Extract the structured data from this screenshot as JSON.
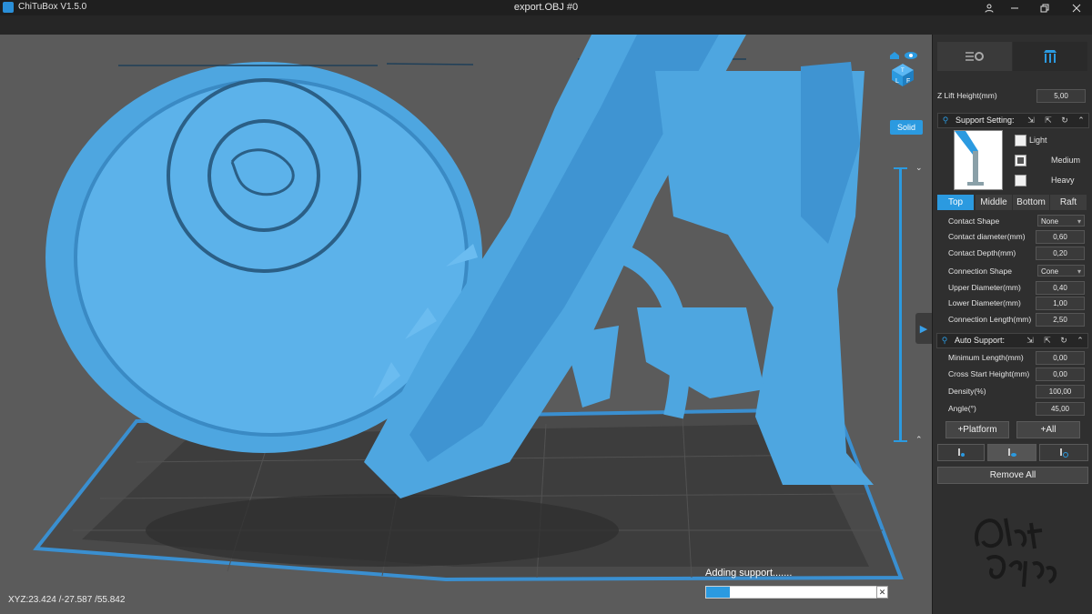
{
  "titlebar": {
    "app_name": "ChiTuBox V1.5.0",
    "document": "export.OBJ #0"
  },
  "viewport": {
    "display_mode": "Solid",
    "coordinates": "XYZ:23.424 /-27.587 /55.842",
    "progress": {
      "label": "Adding support.......",
      "fraction": 0.14
    }
  },
  "panel": {
    "z_lift": {
      "label": "Z Lift Height(mm)",
      "value": "5,00"
    },
    "support_setting": {
      "title": "Support Setting:",
      "presets": [
        {
          "label": "Light",
          "checked": false
        },
        {
          "label": "Medium",
          "checked": true
        },
        {
          "label": "Heavy",
          "checked": false
        }
      ],
      "tabs": [
        "Top",
        "Middle",
        "Bottom",
        "Raft"
      ],
      "active_tab": "Top",
      "contact_shape": {
        "label": "Contact Shape",
        "value": "None"
      },
      "contact_diameter": {
        "label": "Contact diameter(mm)",
        "value": "0,60"
      },
      "contact_depth": {
        "label": "Contact Depth(mm)",
        "value": "0,20"
      },
      "connection_shape": {
        "label": "Connection Shape",
        "value": "Cone"
      },
      "upper_diameter": {
        "label": "Upper Diameter(mm)",
        "value": "0,40"
      },
      "lower_diameter": {
        "label": "Lower Diameter(mm)",
        "value": "1,00"
      },
      "connection_length": {
        "label": "Connection Length(mm)",
        "value": "2,50"
      }
    },
    "auto_support": {
      "title": "Auto Support:",
      "minimum_length": {
        "label": "Minimum Length(mm)",
        "value": "0,00"
      },
      "cross_start_height": {
        "label": "Cross Start Height(mm)",
        "value": "0,00"
      },
      "density": {
        "label": "Density(%)",
        "value": "100,00"
      },
      "angle": {
        "label": "Angle(°)",
        "value": "45,00"
      }
    },
    "buttons": {
      "platform": "+Platform",
      "all": "+All",
      "remove_all": "Remove All"
    }
  },
  "colors": {
    "accent": "#2b9ae0",
    "model": "#4ea6e0",
    "viewport_bg": "#5b5b5b",
    "panel_bg": "#2f2f2f"
  }
}
